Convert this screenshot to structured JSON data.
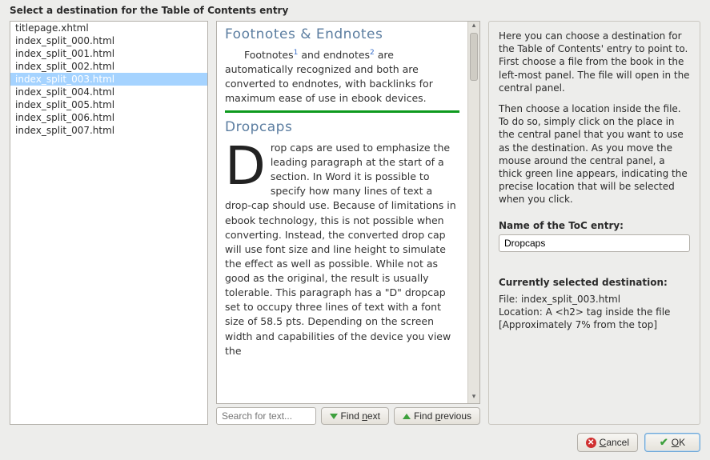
{
  "title": "Select a destination for the Table of Contents entry",
  "files": [
    "titlepage.xhtml",
    "index_split_000.html",
    "index_split_001.html",
    "index_split_002.html",
    "index_split_003.html",
    "index_split_004.html",
    "index_split_005.html",
    "index_split_006.html",
    "index_split_007.html"
  ],
  "selected_file_index": 4,
  "preview": {
    "heading_footnotes": "Footnotes & Endnotes",
    "para_foot_pre": "Footnotes",
    "para_foot_mid": " and endnotes",
    "para_foot_post": " are automatically recognized and both are converted to endnotes, with backlinks for maximum ease of use in ebook devices.",
    "sup1": "1",
    "sup2": "2",
    "heading_dropcaps": "Dropcaps",
    "dropcap_letter": "D",
    "dropcap_rest": "rop caps are used to emphasize the leading paragraph at the start of a section. In Word it is possible to specify how many lines of text a drop-cap should use. Because of limitations in ebook technology, this is not possible when converting. Instead, the converted drop cap will use font size and line height to simulate the effect as well as possible. While not as good as the original, the result is usually tolerable. This paragraph has a \"D\" dropcap set to occupy three lines of text with a font size of 58.5 pts. Depending on the screen width and capabilities of the device you view the"
  },
  "search": {
    "placeholder": "Search for text...",
    "find_next": "Find next",
    "find_prev": "Find previous"
  },
  "instructions": {
    "p1": "Here you can choose a destination for the Table of Contents' entry to point to. First choose a file from the book in the left-most panel. The file will open in the central panel.",
    "p2": "Then choose a location inside the file. To do so, simply click on the place in the central panel that you want to use as the destination. As you move the mouse around the central panel, a thick green line appears, indicating the precise location that will be selected when you click."
  },
  "toc_entry": {
    "label": "Name of the ToC entry:",
    "value": "Dropcaps"
  },
  "destination": {
    "label": "Currently selected destination:",
    "file": "File: index_split_003.html",
    "loc": "Location: A <h2> tag inside the file",
    "approx": "[Approximately 7% from the top]"
  },
  "buttons": {
    "cancel": "Cancel",
    "ok": "OK"
  }
}
